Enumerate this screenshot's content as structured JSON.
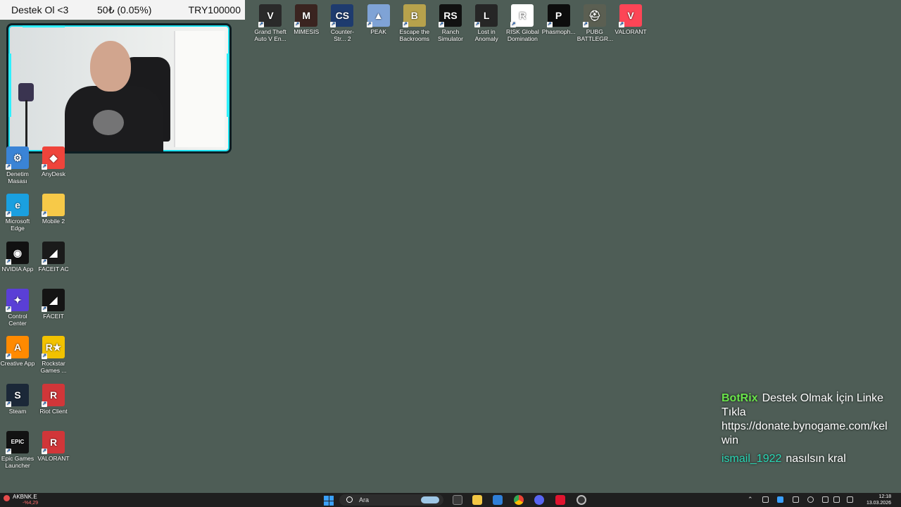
{
  "donation_bar": {
    "label": "Destek Ol <3",
    "amount": "50₺ (0.05%)",
    "goal": "TRY100000"
  },
  "desktop_top_icons": [
    {
      "label": "Grand Theft Auto V En...",
      "icon": "gta-icon",
      "color": "#2a2a2a",
      "glyph": "V"
    },
    {
      "label": "MIMESIS",
      "icon": "mimesis-icon",
      "color": "#3a2420",
      "glyph": "M"
    },
    {
      "label": "Counter-Str... 2",
      "icon": "counter-strike-icon",
      "color": "#1e3b6e",
      "glyph": "CS"
    },
    {
      "label": "PEAK",
      "icon": "peak-icon",
      "color": "#7fa3d6",
      "glyph": "▲"
    },
    {
      "label": "Escape the Backrooms",
      "icon": "backrooms-icon",
      "color": "#b7a24c",
      "glyph": "B"
    },
    {
      "label": "Ranch Simulator",
      "icon": "ranch-simulator-icon",
      "color": "#111111",
      "glyph": "RS"
    },
    {
      "label": "Lost in Anomaly",
      "icon": "anomaly-icon",
      "color": "#262626",
      "glyph": "L"
    },
    {
      "label": "RISK Global Domination",
      "icon": "risk-icon",
      "color": "#ffffff",
      "glyph": "R"
    },
    {
      "label": "Phasmoph...",
      "icon": "phasmophobia-icon",
      "color": "#0d0d0d",
      "glyph": "P"
    },
    {
      "label": "PUBG BATTLEGR...",
      "icon": "pubg-icon",
      "color": "#5b5f52",
      "glyph": "⛑"
    },
    {
      "label": "VALORANT",
      "icon": "valorant-icon",
      "color": "#fd4556",
      "glyph": "V"
    }
  ],
  "desktop_left_icons": [
    {
      "label": "Denetim Masası",
      "icon": "control-panel-icon",
      "color": "#3a84d6",
      "glyph": "⚙"
    },
    {
      "label": "AnyDesk",
      "icon": "anydesk-icon",
      "color": "#ef443b",
      "glyph": "◆"
    },
    {
      "label": "Microsoft Edge",
      "icon": "edge-icon",
      "color": "#1aa0e0",
      "glyph": "e"
    },
    {
      "label": "Mobile 2",
      "icon": "folder-icon",
      "color": "#f7c948",
      "glyph": ""
    },
    {
      "label": "NVIDIA App",
      "icon": "nvidia-icon",
      "color": "#111111",
      "glyph": "◉"
    },
    {
      "label": "FACEIT AC",
      "icon": "faceit-ac-icon",
      "color": "#1a1a1a",
      "glyph": "◢"
    },
    {
      "label": "Control Center",
      "icon": "control-center-icon",
      "color": "#5a3fd6",
      "glyph": "✦"
    },
    {
      "label": "FACEIT",
      "icon": "faceit-icon",
      "color": "#141414",
      "glyph": "◢"
    },
    {
      "label": "Creative App",
      "icon": "creative-app-icon",
      "color": "#ff8a00",
      "glyph": "A"
    },
    {
      "label": "Rockstar Games ...",
      "icon": "rockstar-icon",
      "color": "#f2c200",
      "glyph": "R★"
    },
    {
      "label": "Steam",
      "icon": "steam-icon",
      "color": "#1b2838",
      "glyph": "S"
    },
    {
      "label": "Riot Client",
      "icon": "riot-client-icon",
      "color": "#d13639",
      "glyph": "R"
    },
    {
      "label": "Epic Games Launcher",
      "icon": "epic-games-icon",
      "color": "#121212",
      "glyph": "EPIC"
    },
    {
      "label": "VALORANT",
      "icon": "valorant-riot-icon",
      "color": "#d13639",
      "glyph": "R"
    }
  ],
  "chat": {
    "messages": [
      {
        "user": "BotRix",
        "text": "Destek Olmak İçin Linke Tıkla https://donate.bynogame.com/kel win"
      },
      {
        "user": "ismail_1922",
        "text": "nasılsın kral"
      }
    ]
  },
  "taskbar": {
    "weather_ticker": "AKBNK.E",
    "weather_change": "-%4,29",
    "search_placeholder": "Ara",
    "apps": [
      "task-view-icon",
      "file-explorer-icon",
      "store-icon",
      "chrome-icon",
      "discord-icon",
      "app-red-icon",
      "obs-icon"
    ],
    "clock_time": "12:18",
    "clock_date": "13.03.2026",
    "colors": {
      "accent": "#3aa0ff",
      "bg": "#1f1f1f"
    }
  }
}
